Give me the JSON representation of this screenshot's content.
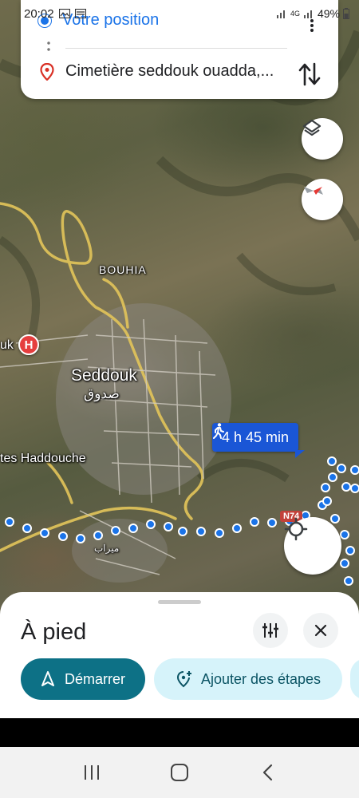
{
  "status_bar": {
    "time": "20:02",
    "network": "4G",
    "battery": "49%"
  },
  "route": {
    "origin": "Votre position",
    "destination": "Cimetière seddouk ouadda,..."
  },
  "map": {
    "labels": {
      "bouhia": "BOUHIA",
      "seddouk": "Seddouk",
      "seddouk_ar": "صدوق",
      "haddouche": "tes Haddouche",
      "uk": "uk",
      "arab2": "ميراب"
    },
    "hospital_marker": "H",
    "road_shield": "N74",
    "duration": "4 h 45 min"
  },
  "sheet": {
    "title": "À pied",
    "start_label": "Démarrer",
    "add_stops_label": "Ajouter des étapes"
  },
  "colors": {
    "route_blue": "#1a73e8",
    "start_teal": "#0d7186",
    "chip_light": "#d6f3fa",
    "duration_bg": "#1a56d6"
  }
}
